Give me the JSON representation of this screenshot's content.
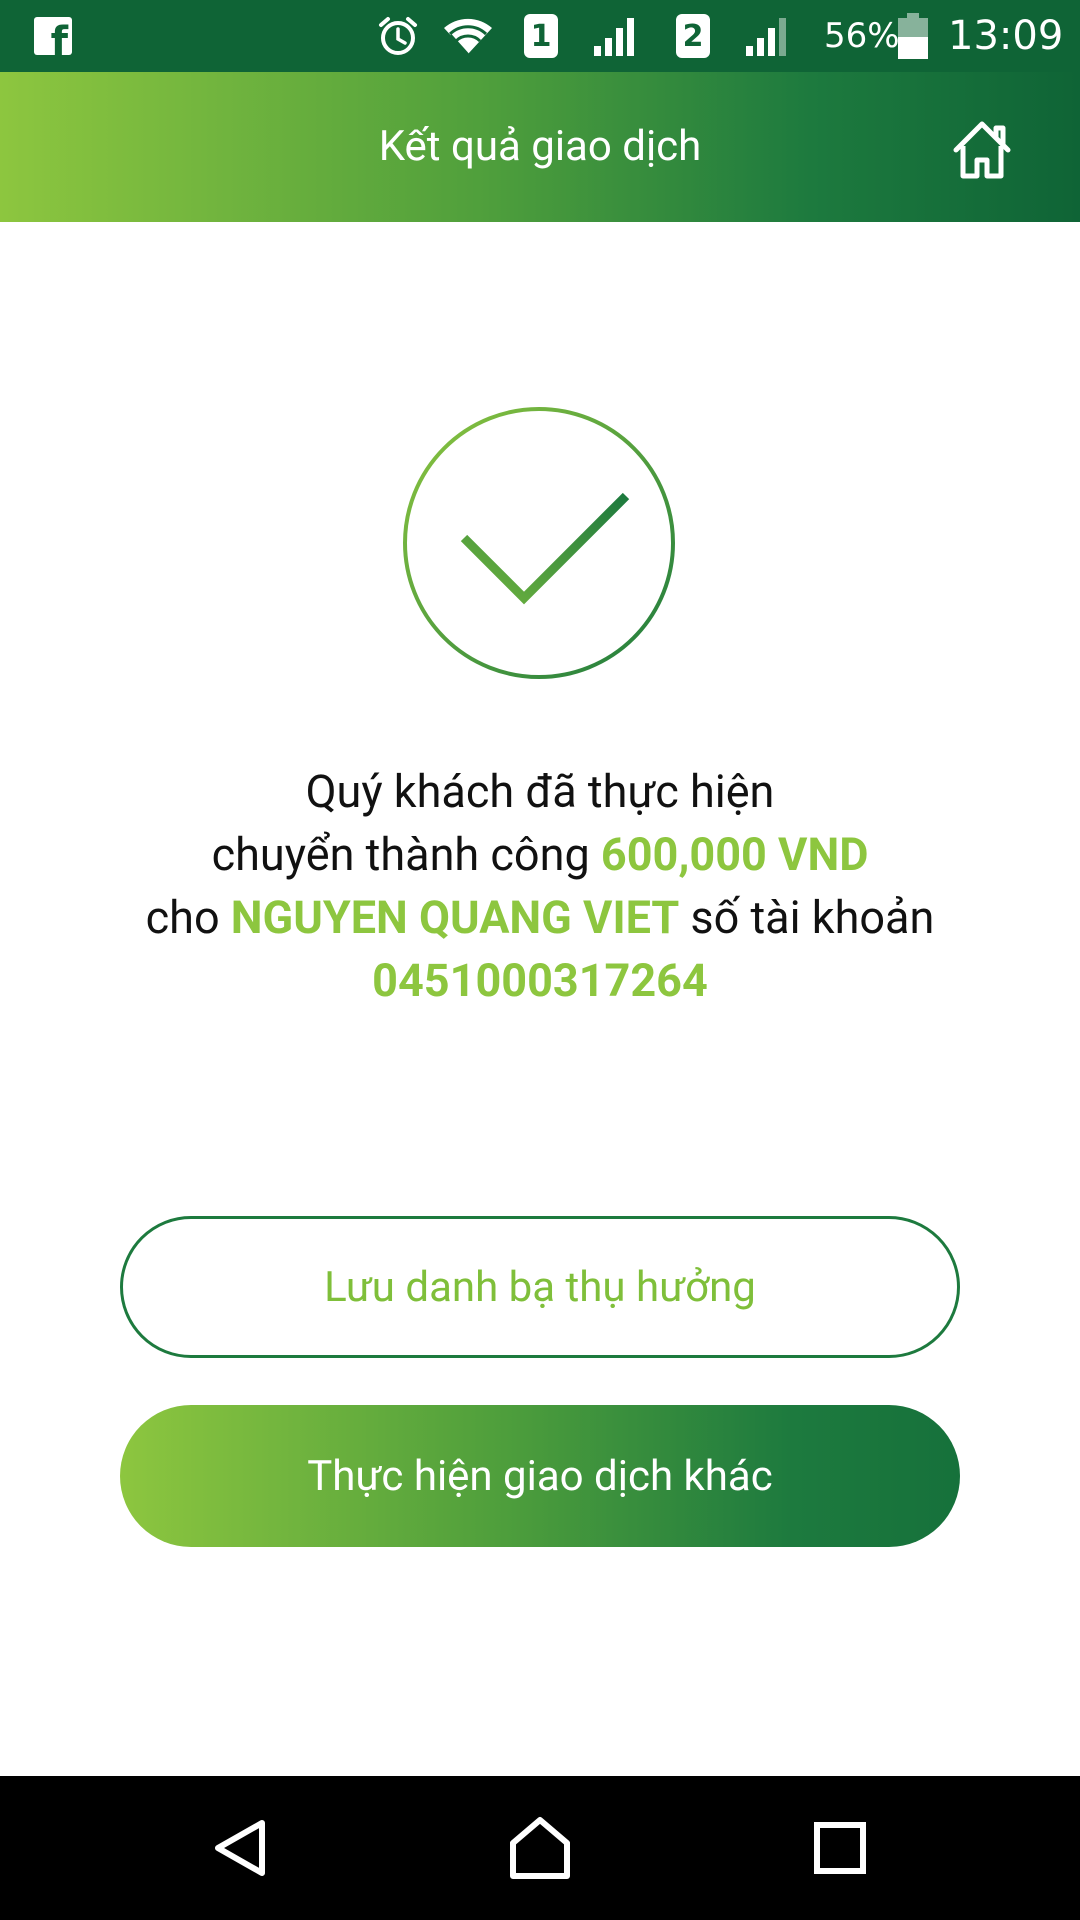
{
  "status_bar": {
    "battery_percent": "56%",
    "time": "13:09",
    "sim1_label": "1",
    "sim2_label": "2",
    "icons": [
      "facebook-icon",
      "alarm-icon",
      "wifi-icon",
      "sim1-icon",
      "signal-icon",
      "sim2-icon",
      "signal-icon",
      "battery-icon"
    ]
  },
  "header": {
    "title": "Kết quả giao dịch",
    "home_icon": "home-icon"
  },
  "result": {
    "icon": "check-circle-icon",
    "line1": "Quý khách đã thực hiện",
    "line2_prefix": "chuyển thành công ",
    "amount": "600,000 VND",
    "line3_prefix": "cho ",
    "beneficiary_name": "NGUYEN QUANG VIET",
    "line3_suffix": " số tài khoản",
    "account_number": "0451000317264"
  },
  "actions": {
    "save_contact_label": "Lưu danh bạ thụ hưởng",
    "new_transaction_label": "Thực hiện giao dịch khác"
  },
  "nav_bar": {
    "icons": [
      "back-icon",
      "home-icon",
      "recent-apps-icon"
    ]
  },
  "colors": {
    "status_bar_bg": "#0f6436",
    "accent_green": "#8dc63f",
    "dark_green": "#1d7a3e"
  }
}
